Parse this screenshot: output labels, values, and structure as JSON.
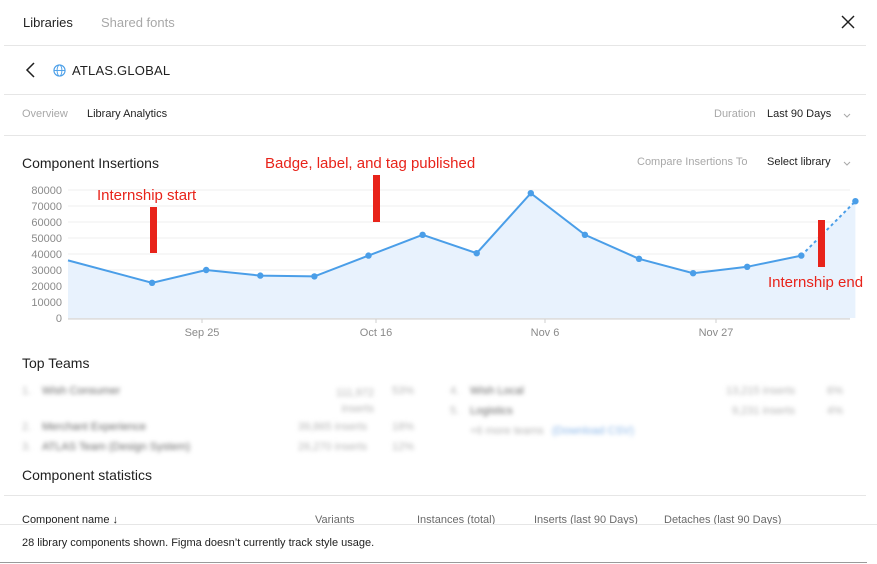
{
  "header": {
    "tabs": [
      {
        "label": "Libraries",
        "active": true
      },
      {
        "label": "Shared fonts",
        "active": false
      }
    ],
    "close_icon": "close-icon"
  },
  "library": {
    "name": "ATLAS.GLOBAL",
    "back_icon": "chevron-left-icon",
    "globe_icon": "globe-icon"
  },
  "subnav": {
    "tabs": [
      {
        "label": "Overview",
        "active": false
      },
      {
        "label": "Library Analytics",
        "active": true
      }
    ],
    "duration_label": "Duration",
    "duration_value": "Last 90 Days"
  },
  "insertions": {
    "title": "Component Insertions",
    "compare_label": "Compare Insertions To",
    "compare_value": "Select library"
  },
  "annotations": {
    "internship_start": "Internship start",
    "badge_published": "Badge, label, and tag published",
    "internship_end": "Internship end"
  },
  "chart_data": {
    "type": "area",
    "yticks": [
      "80000",
      "70000",
      "60000",
      "50000",
      "40000",
      "30000",
      "20000",
      "10000",
      "0"
    ],
    "ylim": [
      0,
      80000
    ],
    "xticks": [
      "Sep 25",
      "Oct 16",
      "Nov 6",
      "Nov 27"
    ],
    "series": [
      {
        "values": [
          36000,
          22000,
          30000,
          26500,
          26000,
          39000,
          52000,
          40500,
          78000,
          52000,
          37000,
          28000,
          32000,
          39000,
          73000
        ],
        "last_segment_dashed": true
      }
    ],
    "line_color": "#4a9ee8",
    "fill_color": "#e8f2fd",
    "grid": true
  },
  "top_teams": {
    "title": "Top Teams",
    "left": [
      {
        "rank": "1.",
        "name": "Wish Consumer",
        "inserts": "111,972 inserts",
        "pct": "53%"
      },
      {
        "rank": "2.",
        "name": "Merchant Experience",
        "inserts": "39,865 inserts",
        "pct": "18%"
      },
      {
        "rank": "3.",
        "name": "ATLAS Team (Design System)",
        "inserts": "26,270 inserts",
        "pct": "12%"
      }
    ],
    "right": [
      {
        "rank": "4.",
        "name": "Wish Local",
        "inserts": "13,215 inserts",
        "pct": "6%"
      },
      {
        "rank": "5.",
        "name": "Logistics",
        "inserts": "9,231 inserts",
        "pct": "4%"
      }
    ],
    "more_text": "+6 more teams",
    "download_link": "(Download CSV)"
  },
  "component_statistics": {
    "title": "Component statistics",
    "columns": [
      "Component name ↓",
      "Variants",
      "Instances (total)",
      "Inserts (last 90 Days)",
      "Detaches (last 90 Days)"
    ]
  },
  "footer": {
    "text": "28 library components shown. Figma doesn’t currently track style usage."
  }
}
